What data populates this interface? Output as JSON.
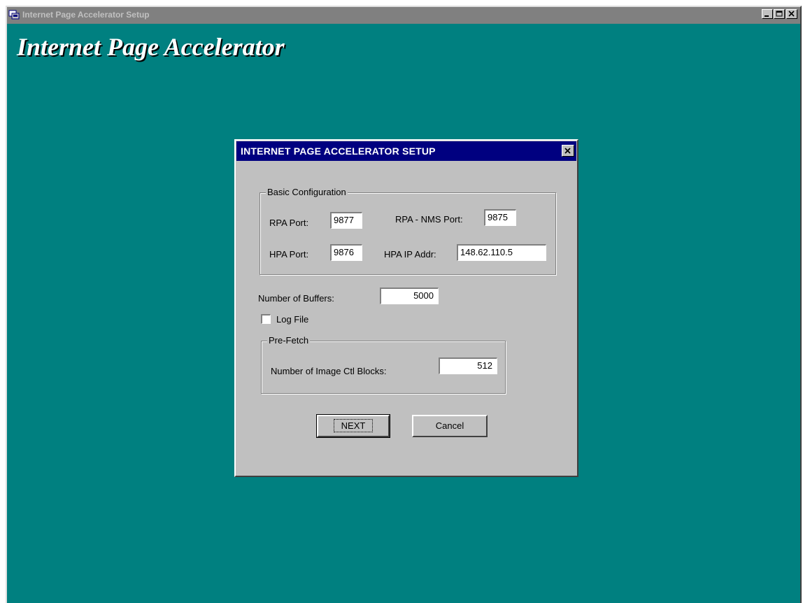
{
  "window": {
    "title": "Internet Page Accelerator Setup",
    "controls": {
      "minimize_icon": "minimize-icon",
      "maximize_icon": "maximize-icon",
      "close_icon": "close-icon"
    }
  },
  "app_heading": "Internet Page Accelerator",
  "dialog": {
    "title": "INTERNET PAGE ACCELERATOR SETUP",
    "close_icon": "close-icon",
    "basic_config": {
      "legend": "Basic Configuration",
      "rpa_port_label": "RPA Port:",
      "rpa_port_value": "9877",
      "rpa_nms_port_label": "RPA - NMS Port:",
      "rpa_nms_port_value": "9875",
      "hpa_port_label": "HPA Port:",
      "hpa_port_value": "9876",
      "hpa_ip_label": "HPA IP Addr:",
      "hpa_ip_value": "148.62.110.5"
    },
    "buffers_label": "Number of Buffers:",
    "buffers_value": "5000",
    "log_file_label": "Log File",
    "log_file_checked": false,
    "prefetch": {
      "legend": "Pre-Fetch",
      "image_blocks_label": "Number of Image Ctl Blocks:",
      "image_blocks_value": "512"
    },
    "next_label": "NEXT",
    "cancel_label": "Cancel"
  },
  "colors": {
    "desktop": "#008080",
    "dialog_title_bar": "#000080",
    "face": "#c0c0c0",
    "inactive_title_bar": "#808080"
  }
}
